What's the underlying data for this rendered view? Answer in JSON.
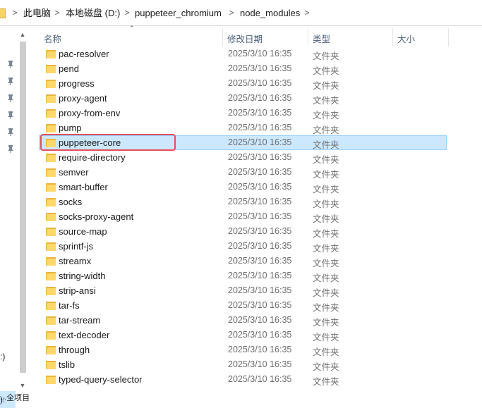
{
  "breadcrumb": {
    "items": [
      "此电脑",
      "本地磁盘 (D:)",
      "puppeteer_chromium",
      "node_modules"
    ],
    "separator": ">"
  },
  "nav": {
    "drive_labels": [
      ":)",
      "):"
    ],
    "partial_bottom": "...全项目"
  },
  "columns": {
    "name": "名称",
    "date": "修改日期",
    "type": "类型",
    "size": "大小"
  },
  "rows": [
    {
      "name": "pac-resolver",
      "date": "2025/3/10 16:35",
      "type": "文件夹"
    },
    {
      "name": "pend",
      "date": "2025/3/10 16:35",
      "type": "文件夹"
    },
    {
      "name": "progress",
      "date": "2025/3/10 16:35",
      "type": "文件夹"
    },
    {
      "name": "proxy-agent",
      "date": "2025/3/10 16:35",
      "type": "文件夹"
    },
    {
      "name": "proxy-from-env",
      "date": "2025/3/10 16:35",
      "type": "文件夹"
    },
    {
      "name": "pump",
      "date": "2025/3/10 16:35",
      "type": "文件夹"
    },
    {
      "name": "puppeteer-core",
      "date": "2025/3/10 16:35",
      "type": "文件夹"
    },
    {
      "name": "require-directory",
      "date": "2025/3/10 16:35",
      "type": "文件夹"
    },
    {
      "name": "semver",
      "date": "2025/3/10 16:35",
      "type": "文件夹"
    },
    {
      "name": "smart-buffer",
      "date": "2025/3/10 16:35",
      "type": "文件夹"
    },
    {
      "name": "socks",
      "date": "2025/3/10 16:35",
      "type": "文件夹"
    },
    {
      "name": "socks-proxy-agent",
      "date": "2025/3/10 16:35",
      "type": "文件夹"
    },
    {
      "name": "source-map",
      "date": "2025/3/10 16:35",
      "type": "文件夹"
    },
    {
      "name": "sprintf-js",
      "date": "2025/3/10 16:35",
      "type": "文件夹"
    },
    {
      "name": "streamx",
      "date": "2025/3/10 16:35",
      "type": "文件夹"
    },
    {
      "name": "string-width",
      "date": "2025/3/10 16:35",
      "type": "文件夹"
    },
    {
      "name": "strip-ansi",
      "date": "2025/3/10 16:35",
      "type": "文件夹"
    },
    {
      "name": "tar-fs",
      "date": "2025/3/10 16:35",
      "type": "文件夹"
    },
    {
      "name": "tar-stream",
      "date": "2025/3/10 16:35",
      "type": "文件夹"
    },
    {
      "name": "text-decoder",
      "date": "2025/3/10 16:35",
      "type": "文件夹"
    },
    {
      "name": "through",
      "date": "2025/3/10 16:35",
      "type": "文件夹"
    },
    {
      "name": "tslib",
      "date": "2025/3/10 16:35",
      "type": "文件夹"
    },
    {
      "name": "typed-query-selector",
      "date": "2025/3/10 16:35",
      "type": "文件夹"
    }
  ],
  "selected_row": "puppeteer-core",
  "icons": {
    "folder": "folder-icon",
    "pin": "pin-icon",
    "chevron": "chevron-right-icon"
  },
  "colors": {
    "selection_bg": "#cce8ff",
    "selection_border": "#99d1ff",
    "highlight_border": "#e2505a",
    "folder": "#ffd86a"
  }
}
